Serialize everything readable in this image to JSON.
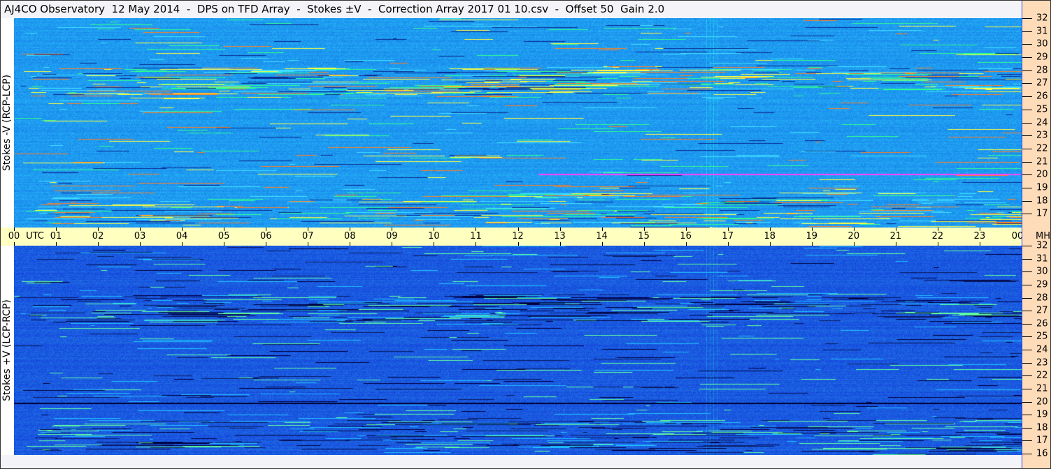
{
  "title": "AJ4CO Observatory  12 May 2014  -  DPS on TFD Array  -  Stokes ±V  -  Correction Array 2017 01 10.csv  -  Offset 50  Gain 2.0",
  "chart_data": {
    "type": "heatmap",
    "title": "AJ4CO Observatory  12 May 2014  -  DPS on TFD Array  -  Stokes ±V  -  Correction Array 2017 01 10.csv  -  Offset 50  Gain 2.0",
    "panels": [
      {
        "ylabel": "Stokes -V (RCP-LCP)",
        "base_color": "#1e9af0"
      },
      {
        "ylabel": "Stokes +V (LCP-RCP)",
        "base_color": "#1a5ae0"
      }
    ],
    "x_unit": "UTC",
    "x_ticks": [
      "00",
      "01",
      "02",
      "03",
      "04",
      "05",
      "06",
      "07",
      "08",
      "09",
      "10",
      "11",
      "12",
      "13",
      "14",
      "15",
      "16",
      "17",
      "18",
      "19",
      "20",
      "21",
      "22",
      "23",
      "00"
    ],
    "y_unit": "MHz",
    "y_ticks": [
      "32",
      "31",
      "30",
      "29",
      "28",
      "27",
      "26",
      "25",
      "24",
      "23",
      "22",
      "21",
      "20",
      "19",
      "18",
      "17",
      "16"
    ],
    "xlim": [
      0,
      24
    ],
    "ylim": [
      16,
      32
    ]
  }
}
